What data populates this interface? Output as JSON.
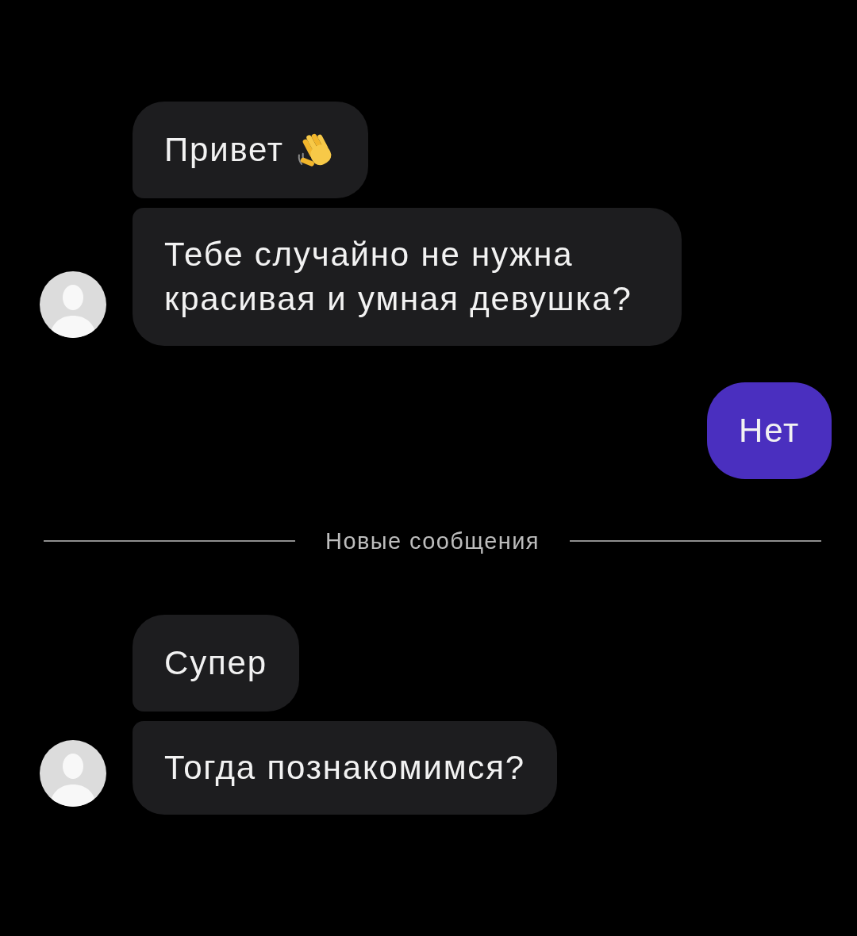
{
  "chat": {
    "items": [
      {
        "kind": "incoming_group",
        "avatar": true,
        "messages": [
          {
            "text": "Привет",
            "trailing_icon": true
          },
          {
            "text": "Тебе случайно не нужна красивая и умная девушка?",
            "trailing_icon": false
          }
        ]
      },
      {
        "kind": "outgoing_group",
        "messages": [
          {
            "text": "Нет",
            "trailing_icon": false
          }
        ]
      },
      {
        "kind": "divider",
        "label": "Новые сообщения"
      },
      {
        "kind": "incoming_group",
        "avatar": true,
        "messages": [
          {
            "text": "Супер",
            "trailing_icon": false
          },
          {
            "text": "Тогда познакомимся?",
            "trailing_icon": false
          }
        ]
      }
    ]
  }
}
